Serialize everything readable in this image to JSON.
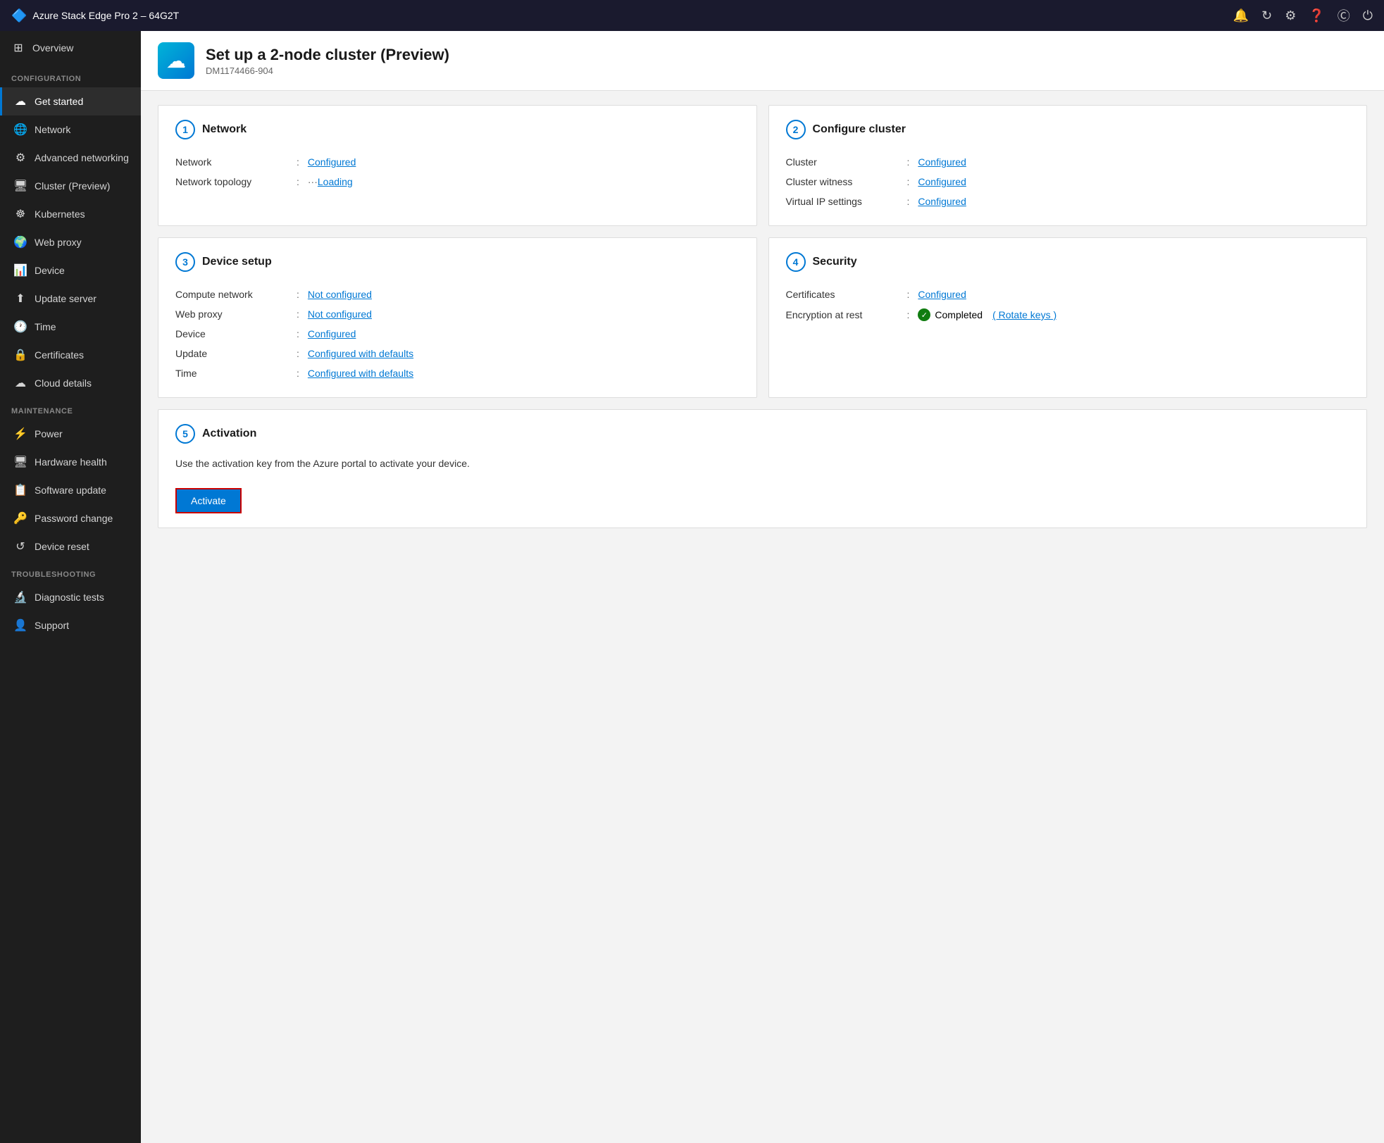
{
  "titleBar": {
    "title": "Azure Stack Edge Pro 2 – 64G2T",
    "icons": [
      "bell",
      "refresh",
      "settings",
      "help",
      "user",
      "power"
    ]
  },
  "sidebar": {
    "overview": {
      "label": "Overview",
      "icon": "⊞"
    },
    "sections": [
      {
        "label": "CONFIGURATION",
        "items": [
          {
            "id": "get-started",
            "label": "Get started",
            "icon": "☁",
            "active": true
          },
          {
            "id": "network",
            "label": "Network",
            "icon": "🌐"
          },
          {
            "id": "advanced-networking",
            "label": "Advanced networking",
            "icon": "⚙"
          },
          {
            "id": "cluster",
            "label": "Cluster (Preview)",
            "icon": "🖥"
          },
          {
            "id": "kubernetes",
            "label": "Kubernetes",
            "icon": "☸"
          },
          {
            "id": "web-proxy",
            "label": "Web proxy",
            "icon": "🌍"
          },
          {
            "id": "device",
            "label": "Device",
            "icon": "📊"
          },
          {
            "id": "update-server",
            "label": "Update server",
            "icon": "⬆"
          },
          {
            "id": "time",
            "label": "Time",
            "icon": "🕐"
          },
          {
            "id": "certificates",
            "label": "Certificates",
            "icon": "🔒"
          },
          {
            "id": "cloud-details",
            "label": "Cloud details",
            "icon": "☁"
          }
        ]
      },
      {
        "label": "MAINTENANCE",
        "items": [
          {
            "id": "power",
            "label": "Power",
            "icon": "⚡"
          },
          {
            "id": "hardware-health",
            "label": "Hardware health",
            "icon": "🖥"
          },
          {
            "id": "software-update",
            "label": "Software update",
            "icon": "📋"
          },
          {
            "id": "password-change",
            "label": "Password change",
            "icon": "🔑"
          },
          {
            "id": "device-reset",
            "label": "Device reset",
            "icon": "↺"
          }
        ]
      },
      {
        "label": "TROUBLESHOOTING",
        "items": [
          {
            "id": "diagnostic-tests",
            "label": "Diagnostic tests",
            "icon": "🔬"
          },
          {
            "id": "support",
            "label": "Support",
            "icon": "👤"
          }
        ]
      }
    ]
  },
  "pageHeader": {
    "title": "Set up a 2-node cluster (Preview)",
    "subtitle": "DM1174466-904"
  },
  "cards": {
    "network": {
      "step": "1",
      "title": "Network",
      "rows": [
        {
          "label": "Network",
          "value": "Configured",
          "type": "link"
        },
        {
          "label": "Network topology",
          "value": "Loading",
          "type": "loading-link"
        }
      ]
    },
    "configure_cluster": {
      "step": "2",
      "title": "Configure cluster",
      "rows": [
        {
          "label": "Cluster",
          "value": "Configured",
          "type": "link"
        },
        {
          "label": "Cluster witness",
          "value": "Configured",
          "type": "link"
        },
        {
          "label": "Virtual IP settings",
          "value": "Configured",
          "type": "link"
        }
      ]
    },
    "device_setup": {
      "step": "3",
      "title": "Device setup",
      "rows": [
        {
          "label": "Compute network",
          "value": "Not configured",
          "type": "link"
        },
        {
          "label": "Web proxy",
          "value": "Not configured",
          "type": "link"
        },
        {
          "label": "Device",
          "value": "Configured",
          "type": "link"
        },
        {
          "label": "Update",
          "value": "Configured with defaults",
          "type": "link"
        },
        {
          "label": "Time",
          "value": "Configured with defaults",
          "type": "link"
        }
      ]
    },
    "security": {
      "step": "4",
      "title": "Security",
      "rows": [
        {
          "label": "Certificates",
          "value": "Configured",
          "type": "link"
        },
        {
          "label": "Encryption at rest",
          "value": "Completed",
          "type": "completed",
          "extra": "( Rotate keys )"
        }
      ]
    },
    "activation": {
      "step": "5",
      "title": "Activation",
      "description": "Use the activation key from the Azure portal to activate your device.",
      "buttonLabel": "Activate"
    }
  }
}
